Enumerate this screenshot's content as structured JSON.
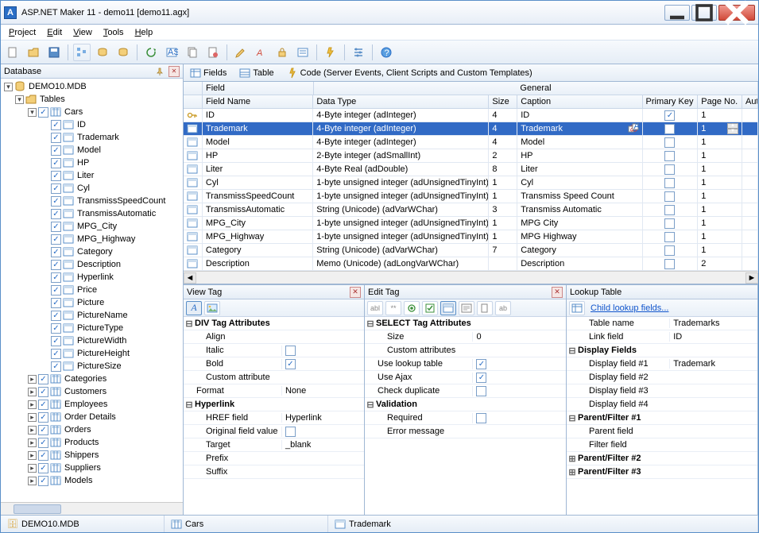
{
  "app": {
    "icon_letter": "A",
    "title": "ASP.NET Maker 11 - demo11 [demo11.agx]"
  },
  "menu": [
    "Project",
    "Edit",
    "View",
    "Tools",
    "Help"
  ],
  "db_panel": {
    "title": "Database"
  },
  "tree": {
    "root": "DEMO10.MDB",
    "tables_label": "Tables",
    "cars": "Cars",
    "fields": [
      "ID",
      "Trademark",
      "Model",
      "HP",
      "Liter",
      "Cyl",
      "TransmissSpeedCount",
      "TransmissAutomatic",
      "MPG_City",
      "MPG_Highway",
      "Category",
      "Description",
      "Hyperlink",
      "Price",
      "Picture",
      "PictureName",
      "PictureType",
      "PictureWidth",
      "PictureHeight",
      "PictureSize"
    ],
    "others": [
      "Categories",
      "Customers",
      "Employees",
      "Order Details",
      "Orders",
      "Products",
      "Shippers",
      "Suppliers",
      "Models"
    ]
  },
  "tabs": {
    "fields": "Fields",
    "table": "Table",
    "code": "Code (Server Events, Client Scripts and Custom Templates)"
  },
  "grid": {
    "group_field": "Field",
    "group_general": "General",
    "col_name": "Field Name",
    "col_dt": "Data Type",
    "col_size": "Size",
    "col_cap": "Caption",
    "col_pk": "Primary Key",
    "col_pn": "Page No.",
    "col_aut": "Aut",
    "rows": [
      {
        "name": "ID",
        "dt": "4-Byte integer (adInteger)",
        "size": "4",
        "cap": "ID",
        "pk": true,
        "pn": "1",
        "key": true
      },
      {
        "name": "Trademark",
        "dt": "4-Byte integer (adInteger)",
        "size": "4",
        "cap": "Trademark",
        "pk": false,
        "pn": "1",
        "sel": true
      },
      {
        "name": "Model",
        "dt": "4-Byte integer (adInteger)",
        "size": "4",
        "cap": "Model",
        "pk": false,
        "pn": "1"
      },
      {
        "name": "HP",
        "dt": "2-Byte integer (adSmallInt)",
        "size": "2",
        "cap": "HP",
        "pk": false,
        "pn": "1"
      },
      {
        "name": "Liter",
        "dt": "4-Byte Real (adDouble)",
        "size": "8",
        "cap": "Liter",
        "pk": false,
        "pn": "1"
      },
      {
        "name": "Cyl",
        "dt": "1-byte unsigned integer (adUnsignedTinyInt)",
        "size": "1",
        "cap": "Cyl",
        "pk": false,
        "pn": "1"
      },
      {
        "name": "TransmissSpeedCount",
        "dt": "1-byte unsigned integer (adUnsignedTinyInt)",
        "size": "1",
        "cap": "Transmiss Speed Count",
        "pk": false,
        "pn": "1"
      },
      {
        "name": "TransmissAutomatic",
        "dt": "String (Unicode) (adVarWChar)",
        "size": "3",
        "cap": "Transmiss Automatic",
        "pk": false,
        "pn": "1"
      },
      {
        "name": "MPG_City",
        "dt": "1-byte unsigned integer (adUnsignedTinyInt)",
        "size": "1",
        "cap": "MPG City",
        "pk": false,
        "pn": "1"
      },
      {
        "name": "MPG_Highway",
        "dt": "1-byte unsigned integer (adUnsignedTinyInt)",
        "size": "1",
        "cap": "MPG Highway",
        "pk": false,
        "pn": "1"
      },
      {
        "name": "Category",
        "dt": "String (Unicode) (adVarWChar)",
        "size": "7",
        "cap": "Category",
        "pk": false,
        "pn": "1"
      },
      {
        "name": "Description",
        "dt": "Memo (Unicode) (adLongVarWChar)",
        "size": "",
        "cap": "Description",
        "pk": false,
        "pn": "2"
      }
    ]
  },
  "view_tag": {
    "title": "View Tag",
    "cat1": "DIV Tag Attributes",
    "p_align": "Align",
    "p_italic": "Italic",
    "p_bold": "Bold",
    "p_custom": "Custom attribute",
    "p_format": "Format",
    "v_format": "None",
    "cat2": "Hyperlink",
    "p_href": "HREF field",
    "v_href": "Hyperlink",
    "p_orig": "Original field value",
    "p_target": "Target",
    "v_target": "_blank",
    "p_prefix": "Prefix",
    "p_suffix": "Suffix",
    "bold_checked": true
  },
  "edit_tag": {
    "title": "Edit Tag",
    "cat1": "SELECT Tag Attributes",
    "p_size": "Size",
    "v_size": "0",
    "p_custom": "Custom attributes",
    "p_lookup": "Use lookup table",
    "p_ajax": "Use Ajax",
    "p_dup": "Check duplicate",
    "cat2": "Validation",
    "p_req": "Required",
    "p_err": "Error message",
    "lookup_checked": true,
    "ajax_checked": true
  },
  "lookup": {
    "title": "Lookup Table",
    "link": "Child lookup fields...",
    "p_table": "Table name",
    "v_table": "Trademarks",
    "p_link": "Link field",
    "v_link": "ID",
    "cat1": "Display Fields",
    "p_d1": "Display field #1",
    "v_d1": "Trademark",
    "p_d2": "Display field #2",
    "p_d3": "Display field #3",
    "p_d4": "Display field #4",
    "cat2": "Parent/Filter #1",
    "p_pf": "Parent field",
    "p_ff": "Filter field",
    "cat3": "Parent/Filter #2",
    "cat4": "Parent/Filter #3"
  },
  "status": {
    "s1": "DEMO10.MDB",
    "s2": "Cars",
    "s3": "Trademark"
  }
}
